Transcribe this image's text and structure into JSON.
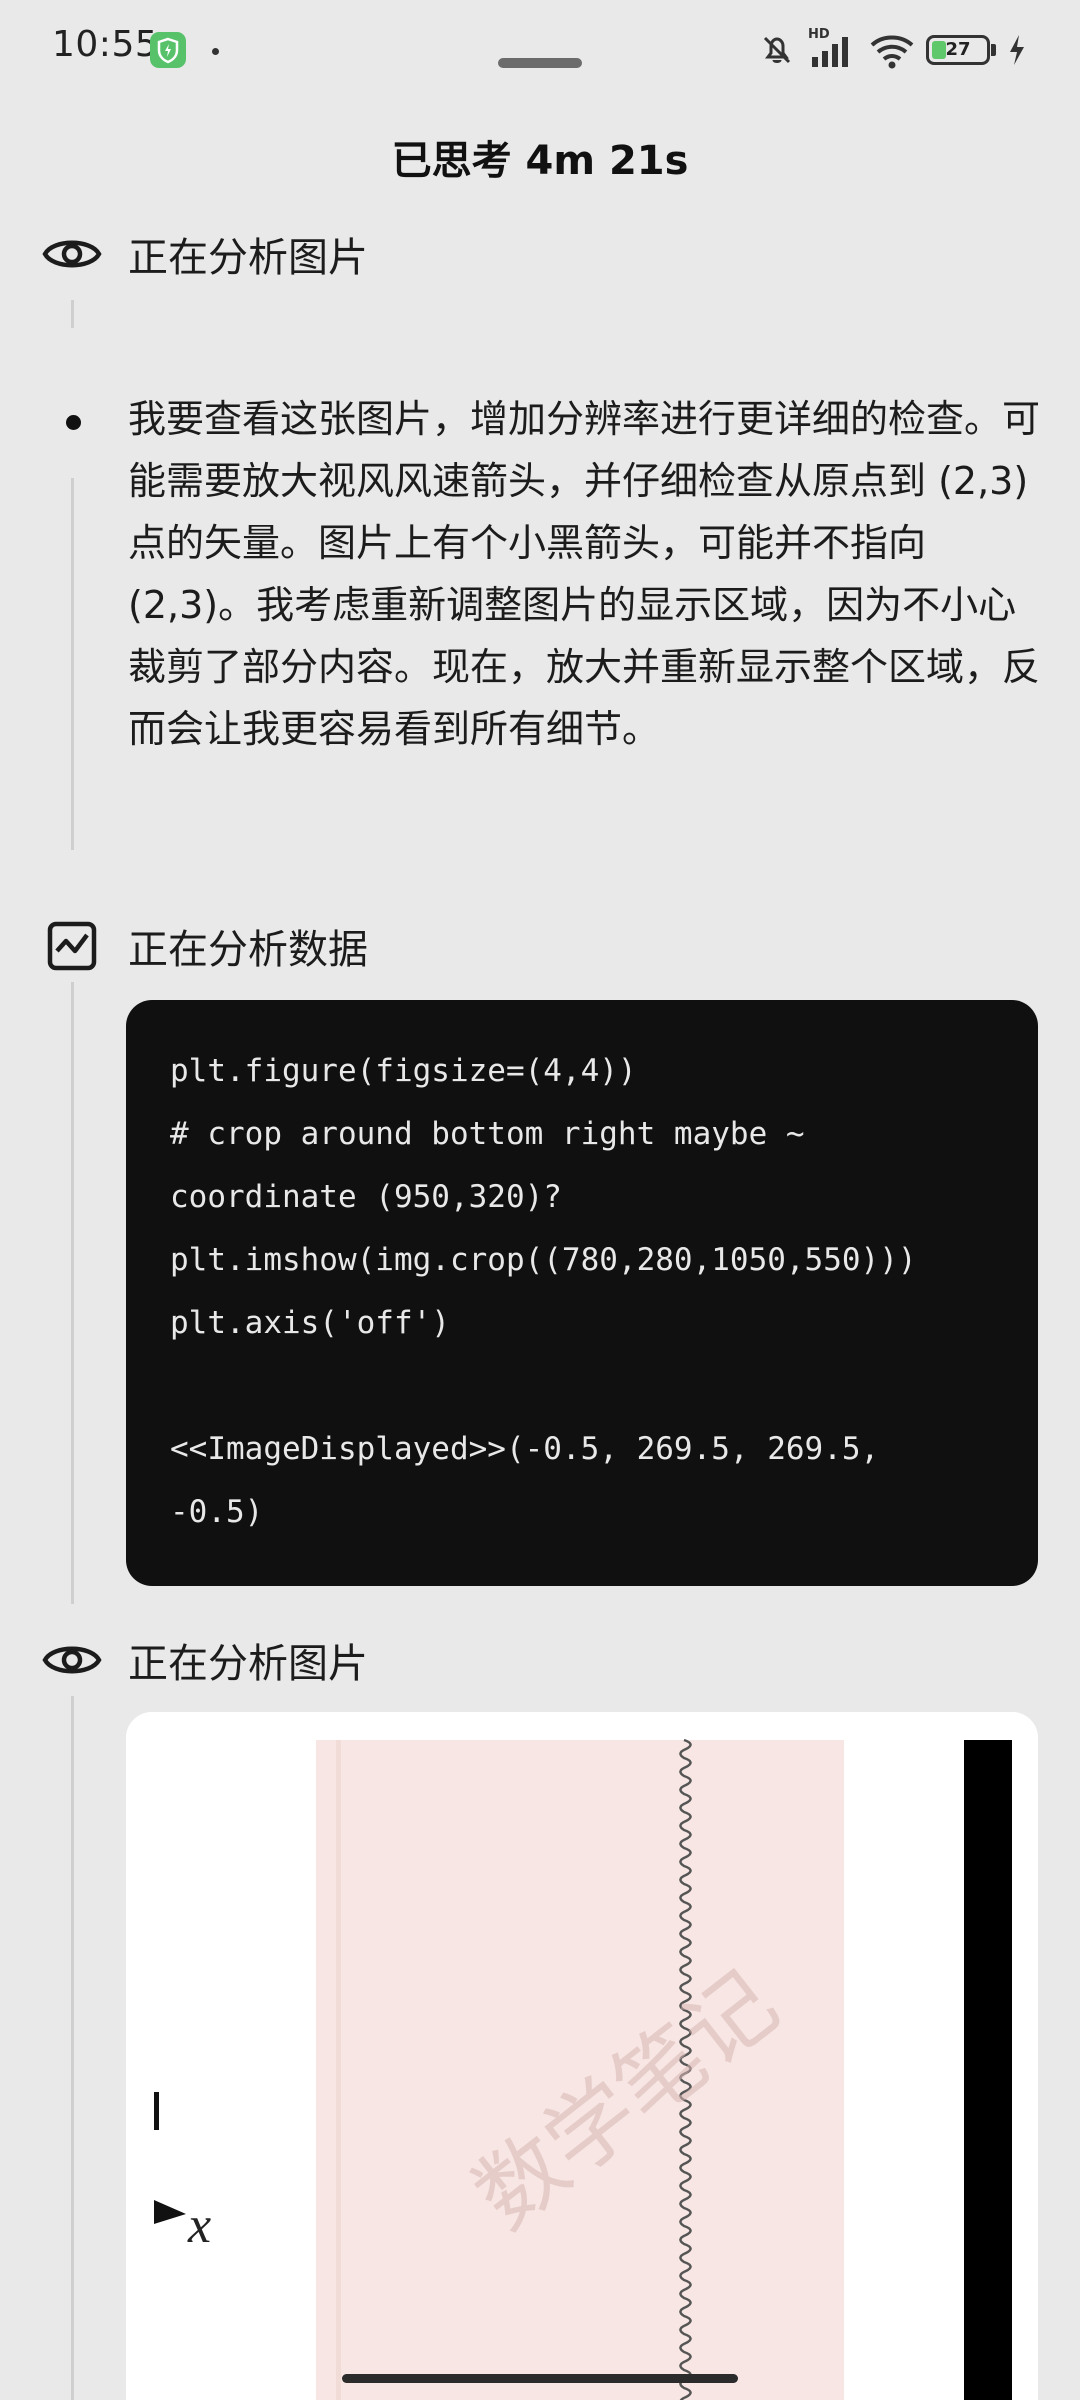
{
  "status_bar": {
    "time": "10:55",
    "hd_label": "HD",
    "battery_level": "27",
    "icons": [
      "shield-icon",
      "mute-icon",
      "signal-icon",
      "wifi-icon",
      "battery-icon",
      "charging-icon"
    ]
  },
  "sheet": {
    "title": "已思考 4m 21s"
  },
  "steps": [
    {
      "label": "正在分析图片",
      "icon": "eye-icon"
    },
    {
      "label": "正在分析数据",
      "icon": "chart-icon"
    },
    {
      "label": "正在分析图片",
      "icon": "eye-icon"
    }
  ],
  "thought": {
    "text": "我要查看这张图片，增加分辨率进行更详细的检查。可能需要放大视风风速箭头，并仔细检查从原点到 (2,3) 点的矢量。图片上有个小黑箭头，可能并不指向 (2,3)。我考虑重新调整图片的显示区域，因为不小心裁剪了部分内容。现在，放大并重新显示整个区域，反而会让我更容易看到所有细节。"
  },
  "code": {
    "lines": [
      "plt.figure(figsize=(4,4))",
      "# crop around bottom right maybe ~",
      "coordinate (950,320)?",
      "plt.imshow(img.crop((780,280,1050,550)))",
      "plt.axis('off')",
      "",
      "<<ImageDisplayed>>(-0.5, 269.5, 269.5,",
      "-0.5)"
    ]
  },
  "image_preview": {
    "axis_label": "x",
    "watermark": "数学笔记",
    "colors": {
      "paper": "#f7e6e3",
      "bar": "#000000"
    }
  }
}
